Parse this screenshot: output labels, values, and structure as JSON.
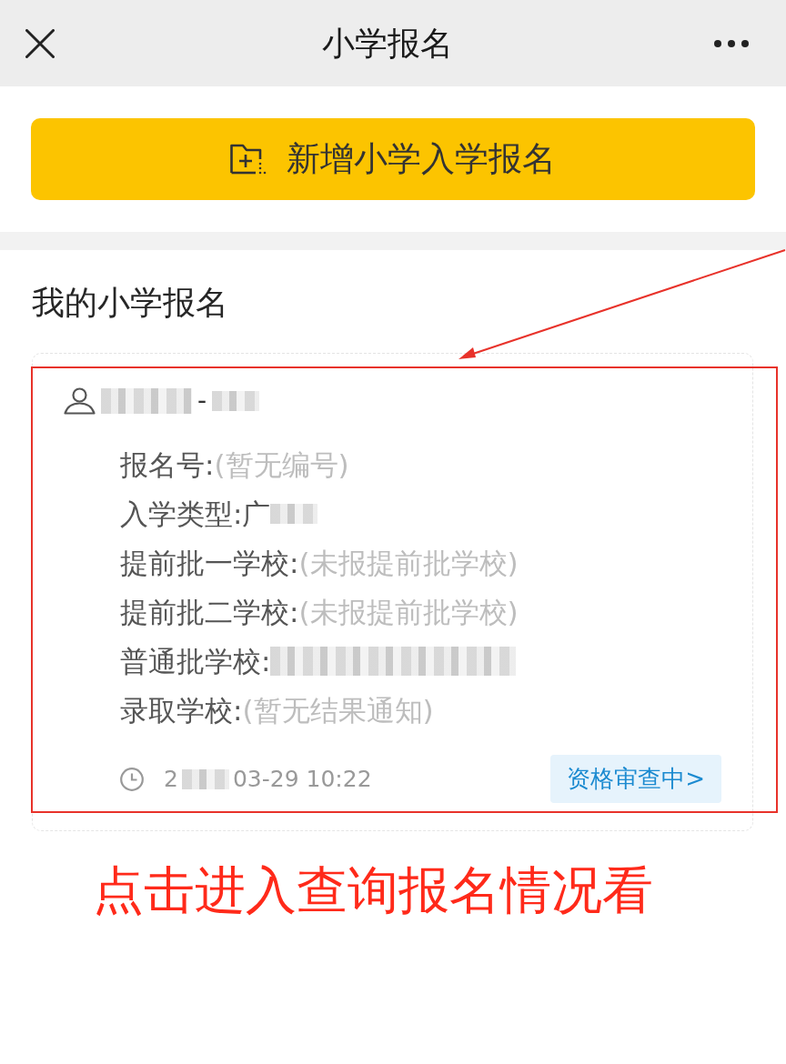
{
  "header": {
    "title": "小学报名"
  },
  "add_button": {
    "label": "新增小学入学报名"
  },
  "section": {
    "title": "我的小学报名"
  },
  "applications": [
    {
      "highlighted": true,
      "name_parts": [
        {
          "kind": "blur"
        },
        {
          "kind": "text",
          "text": "-"
        },
        {
          "kind": "blur_short"
        }
      ],
      "fields": [
        {
          "label": "报名号:",
          "value": [
            {
              "kind": "pending",
              "text": "(暂无编号)"
            }
          ]
        },
        {
          "label": "入学类型:",
          "value": [
            {
              "kind": "text",
              "text": "广"
            },
            {
              "kind": "blur_short"
            }
          ]
        },
        {
          "label": "提前批一学校:",
          "value": [
            {
              "kind": "pending",
              "text": "(未报提前批学校)"
            }
          ]
        },
        {
          "label": "提前批二学校:",
          "value": [
            {
              "kind": "pending",
              "text": "(未报提前批学校)"
            }
          ]
        },
        {
          "label": "普通批学校:",
          "value": [
            {
              "kind": "blur_long"
            }
          ]
        },
        {
          "label": "录取学校:",
          "value": [
            {
              "kind": "pending",
              "text": "(暂无结果通知)"
            }
          ]
        }
      ],
      "time_parts": [
        {
          "kind": "text",
          "text": "2"
        },
        {
          "kind": "blur_short"
        },
        {
          "kind": "text",
          "text": "03-29 10:22"
        }
      ],
      "status": "资格审查中>"
    }
  ],
  "annotation": {
    "text": "点击进入查询报名情况看",
    "arrow": true
  }
}
